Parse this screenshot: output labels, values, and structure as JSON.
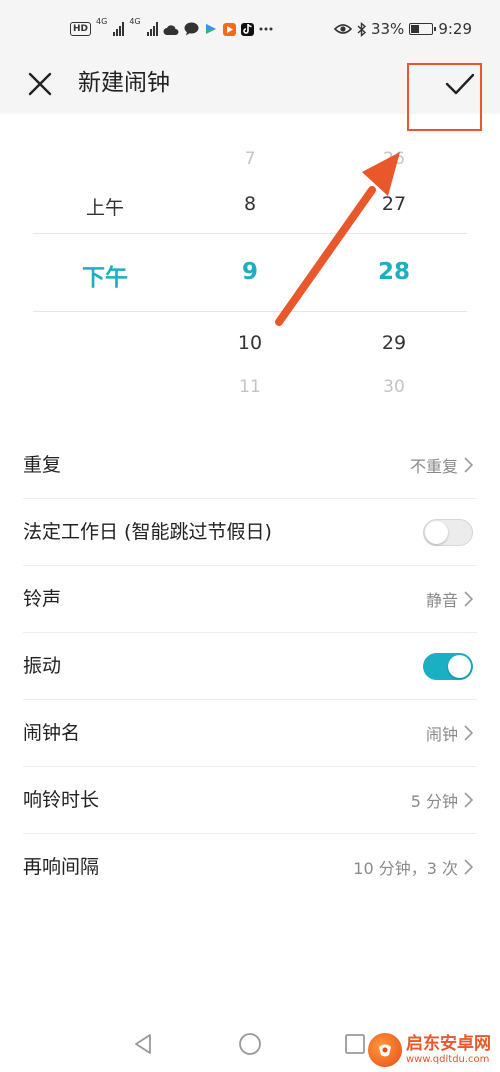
{
  "status_bar": {
    "network_labels": [
      "4G",
      "4G"
    ],
    "hd_label": "HD",
    "battery": "33%",
    "time": "9:29",
    "icons": [
      "hd-voice-icon",
      "signal-icon",
      "signal-icon",
      "cloud-icon",
      "chat-icon",
      "app-icon",
      "video-app-icon",
      "tiktok-icon",
      "more-dots-icon",
      "eye-icon",
      "bluetooth-icon",
      "battery-icon"
    ]
  },
  "header": {
    "title": "新建闹钟",
    "close_icon": "close-icon",
    "confirm_icon": "check-icon"
  },
  "picker": {
    "period": {
      "near_before": "上午",
      "selected": "下午"
    },
    "hour": {
      "far_before": "7",
      "near_before": "8",
      "selected": "9",
      "near_after": "10",
      "far_after": "11"
    },
    "minute": {
      "far_before": "26",
      "near_before": "27",
      "selected": "28",
      "near_after": "29",
      "far_after": "30"
    }
  },
  "settings": {
    "repeat": {
      "label": "重复",
      "value": "不重复"
    },
    "workday": {
      "label": "法定工作日 (智能跳过节假日)",
      "enabled": false
    },
    "ringtone": {
      "label": "铃声",
      "value": "静音"
    },
    "vibrate": {
      "label": "振动",
      "enabled": true
    },
    "alarm_name": {
      "label": "闹钟名",
      "value": "闹钟"
    },
    "ring_duration": {
      "label": "响铃时长",
      "value": "5 分钟"
    },
    "snooze": {
      "label": "再响间隔",
      "value": "10 分钟，3 次"
    }
  },
  "navbar": {
    "icons": [
      "back-icon",
      "home-icon",
      "recents-icon"
    ]
  },
  "watermark": {
    "main": "启东安卓网",
    "url": "www.qdltdu.com"
  },
  "colors": {
    "accent": "#1bafc4",
    "annotation": "#e8582a"
  }
}
